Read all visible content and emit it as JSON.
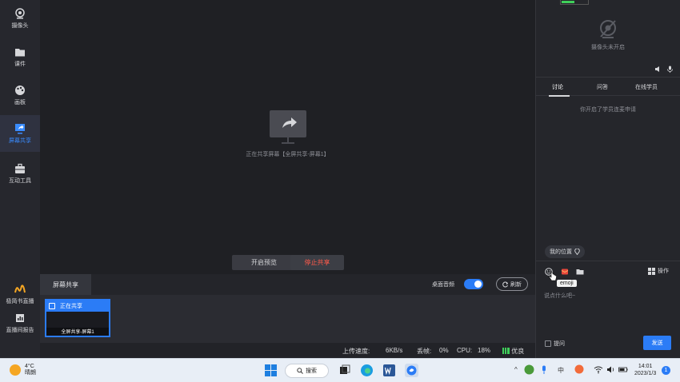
{
  "sidebar": {
    "items": [
      {
        "label": "摄像头",
        "icon": "camera-icon"
      },
      {
        "label": "课件",
        "icon": "courseware-icon"
      },
      {
        "label": "画板",
        "icon": "palette-icon"
      },
      {
        "label": "屏幕共享",
        "icon": "screen-share-icon",
        "active": true
      },
      {
        "label": "互动工具",
        "icon": "toolbox-icon"
      }
    ],
    "bottom_items": [
      {
        "label": "极简书直播",
        "icon": "brand-logo-icon"
      },
      {
        "label": "直播间报告",
        "icon": "report-icon"
      }
    ]
  },
  "stage": {
    "share_status": "正在共享屏幕【全屏共享-屏幕1】",
    "preview_button": "开启预览",
    "stop_button": "停止共享"
  },
  "bottom_panel": {
    "tab_label": "屏幕共享",
    "desktop_audio_label": "桌面音频",
    "desktop_audio_on": true,
    "refresh_label": "刷新",
    "thumbnail": {
      "status": "正在共享",
      "caption": "全屏共享-屏幕1"
    }
  },
  "status_bar": {
    "upload_label": "上传速度:",
    "upload_value": "6KB/s",
    "loss_label": "丢帧:",
    "loss_value": "0%",
    "cpu_label": "CPU:",
    "cpu_value": "18%",
    "quality": "优良"
  },
  "right_panel": {
    "camera_off_label": "摄像头未开启",
    "tabs": [
      "讨论",
      "问答",
      "在线学员"
    ],
    "active_tab": "讨论",
    "notice": "你开启了学员连麦申请",
    "location_label": "我的位置",
    "tooltip": "emoji",
    "ops_label": "操作",
    "input_placeholder": "说点什么吧~",
    "question_label": "提问",
    "send_button": "发送"
  },
  "taskbar": {
    "weather_temp": "4°C",
    "weather_desc": "晴朗",
    "search_label": "搜索",
    "ime_label": "中",
    "time": "14:01",
    "date": "2023/1/3",
    "notification_count": "1"
  },
  "colors": {
    "accent": "#2b7cf6",
    "stop": "#ff5a4a",
    "good": "#3fcf5a"
  }
}
